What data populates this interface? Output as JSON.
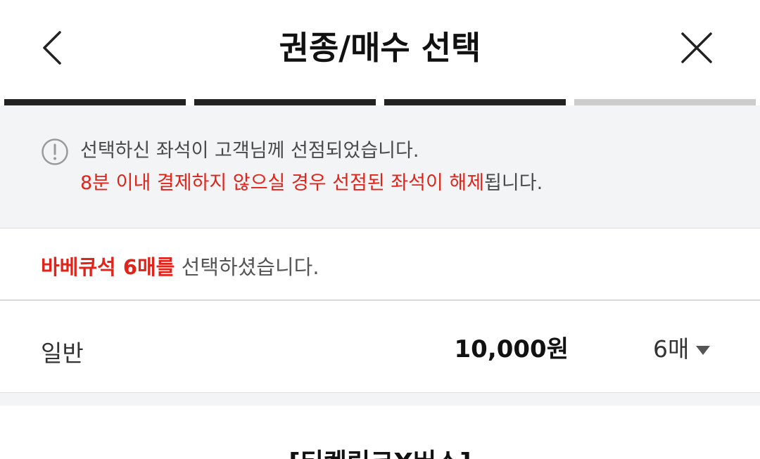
{
  "header": {
    "title": "권종/매수 선택",
    "back_icon": "chevron-left-icon",
    "close_icon": "close-icon"
  },
  "progress": {
    "total_steps": 4,
    "completed_steps": 3,
    "active_color": "#222222",
    "inactive_color": "#cccccc"
  },
  "notice": {
    "icon": "info-circle-icon",
    "line1": "선택하신 좌석이 고객님께 선점되었습니다.",
    "line2_red": "8분 이내 결제하지 않으실 경우 선점된 좌석이 해제",
    "line2_rest": "됩니다."
  },
  "selection": {
    "highlight": "바베큐석 6매를",
    "rest": " 선택하셨습니다."
  },
  "ticket": {
    "type": "일반",
    "price": "10,000원",
    "quantity": "6매"
  },
  "bottom": {
    "title": "[티켓링크X버스]"
  },
  "colors": {
    "accent_red": "#e2231a",
    "notice_bg": "#f3f4f6"
  }
}
